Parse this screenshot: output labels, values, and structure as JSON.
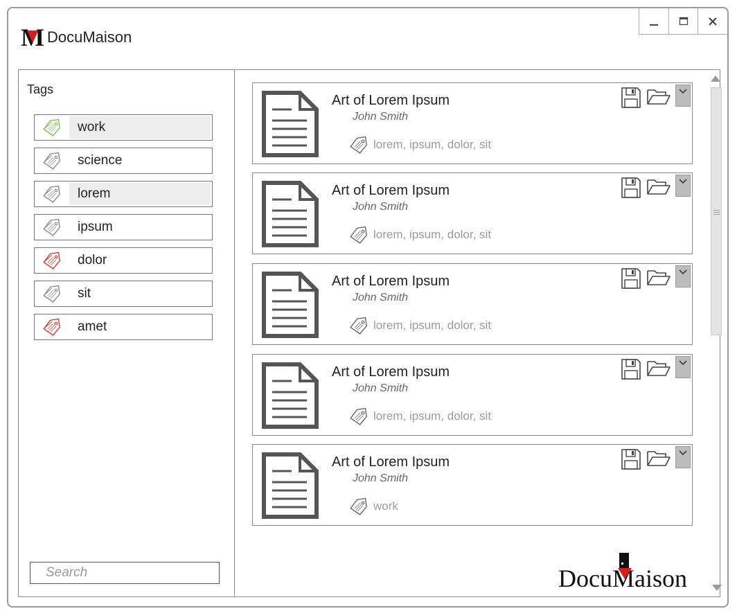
{
  "app": {
    "title": "DocuMaison",
    "logo_letter": "M",
    "accent": "#d01f1f"
  },
  "window": {
    "minimize_icon": "minimize-icon",
    "maximize_icon": "maximize-icon",
    "close_icon": "close-icon"
  },
  "sidebar": {
    "heading": "Tags",
    "items": [
      {
        "label": "work",
        "color": "#8ab85a",
        "selected": true
      },
      {
        "label": "science",
        "color": "#8a8a8a",
        "selected": false
      },
      {
        "label": "lorem",
        "color": "#8a8a8a",
        "selected": true
      },
      {
        "label": "ipsum",
        "color": "#8a8a8a",
        "selected": false
      },
      {
        "label": "dolor",
        "color": "#cc3a3a",
        "selected": false
      },
      {
        "label": "sit",
        "color": "#8a8a8a",
        "selected": false
      },
      {
        "label": "amet",
        "color": "#cc3a3a",
        "selected": false
      }
    ],
    "search": {
      "placeholder": "Search"
    }
  },
  "documents": [
    {
      "title": "Art of Lorem Ipsum",
      "author": "John Smith",
      "tags": "lorem, ipsum, dolor, sit"
    },
    {
      "title": "Art of Lorem Ipsum",
      "author": "John Smith",
      "tags": "lorem, ipsum, dolor, sit"
    },
    {
      "title": "Art of Lorem Ipsum",
      "author": "John Smith",
      "tags": "lorem, ipsum, dolor, sit"
    },
    {
      "title": "Art of Lorem Ipsum",
      "author": "John Smith",
      "tags": "lorem, ipsum, dolor, sit"
    },
    {
      "title": "Art of Lorem Ipsum",
      "author": "John Smith",
      "tags": "work"
    }
  ],
  "footer": {
    "logo_prefix": "Docu",
    "logo_m": "M",
    "logo_suffix": "aison"
  }
}
